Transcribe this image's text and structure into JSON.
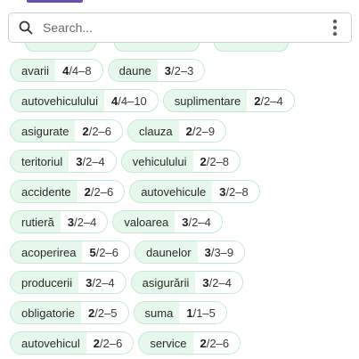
{
  "search": {
    "placeholder": "Search..."
  },
  "colors": {
    "accent": "#6a4fb3",
    "tag_fill": "#e6f7ec",
    "tag_border": "#c5e9d3"
  },
  "rows": [
    [
      {
        "word": "avarii",
        "bold": "4",
        "rest": "/4–8"
      },
      {
        "word": "daune",
        "bold": "3",
        "rest": "/2–3"
      }
    ],
    [
      {
        "word": "autovehiculului",
        "bold": "4",
        "rest": "/4–10"
      },
      {
        "word": "suplimentare",
        "bold": "2",
        "rest": "/2–4"
      }
    ],
    [
      {
        "word": "asigurate",
        "bold": "2",
        "rest": "/2–6"
      },
      {
        "word": "clauza",
        "bold": "2",
        "rest": "/2–9"
      }
    ],
    [
      {
        "word": "teritoriul",
        "bold": "3",
        "rest": "/2–4"
      },
      {
        "word": "vehiculului",
        "bold": "2",
        "rest": "/2–8"
      }
    ],
    [
      {
        "word": "accidente",
        "bold": "2",
        "rest": "/2–6"
      },
      {
        "word": "autovehicule",
        "bold": "3",
        "rest": "/2–8"
      }
    ],
    [
      {
        "word": "rutieră",
        "bold": "3",
        "rest": "/2–4"
      },
      {
        "word": "valoarea",
        "bold": "3",
        "rest": "/2–4"
      }
    ],
    [
      {
        "word": "acoperirea",
        "bold": "5",
        "rest": "/2–6"
      },
      {
        "word": "daunelor",
        "bold": "3",
        "rest": "/3–9"
      }
    ],
    [
      {
        "word": "producerii",
        "bold": "3",
        "rest": "/2–4"
      },
      {
        "word": "asigurării",
        "bold": "3",
        "rest": "/2–4"
      }
    ],
    [
      {
        "word": "obligatorie",
        "bold": "2",
        "rest": "/2–5"
      },
      {
        "word": "suma",
        "bold": "1",
        "rest": "/1–5"
      }
    ],
    [
      {
        "word": "autovehicul",
        "bold": "2",
        "rest": "/2–6"
      },
      {
        "word": "service",
        "bold": "2",
        "rest": "/2–6"
      }
    ]
  ]
}
